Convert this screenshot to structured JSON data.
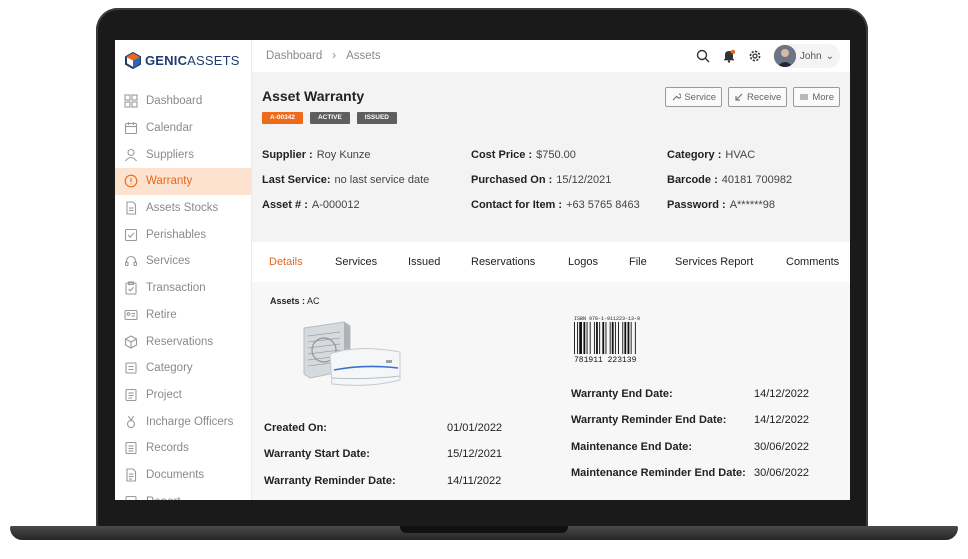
{
  "app": {
    "logo_prefix": "GENIC",
    "logo_suffix": "ASSETS"
  },
  "sidebar": {
    "items": [
      {
        "label": "Dashboard",
        "icon": "grid-icon",
        "active": false
      },
      {
        "label": "Calendar",
        "icon": "calendar-icon",
        "active": false
      },
      {
        "label": "Suppliers",
        "icon": "person-icon",
        "active": false
      },
      {
        "label": "Warranty",
        "icon": "alert-circle-icon",
        "active": true
      },
      {
        "label": "Assets Stocks",
        "icon": "document-icon",
        "active": false
      },
      {
        "label": "Perishables",
        "icon": "check-square-icon",
        "active": false
      },
      {
        "label": "Services",
        "icon": "headset-icon",
        "active": false
      },
      {
        "label": "Transaction",
        "icon": "clipboard-icon",
        "active": false
      },
      {
        "label": "Retire",
        "icon": "id-card-icon",
        "active": false
      },
      {
        "label": "Reservations",
        "icon": "cube-icon",
        "active": false
      },
      {
        "label": "Category",
        "icon": "tag-icon",
        "active": false
      },
      {
        "label": "Project",
        "icon": "list-icon",
        "active": false
      },
      {
        "label": "Incharge Officers",
        "icon": "medal-icon",
        "active": false
      },
      {
        "label": "Records",
        "icon": "records-icon",
        "active": false
      },
      {
        "label": "Documents",
        "icon": "documents-icon",
        "active": false
      },
      {
        "label": "Report",
        "icon": "report-icon",
        "active": false
      }
    ]
  },
  "topbar": {
    "breadcrumb": [
      "Dashboard",
      "Assets"
    ],
    "user_name": "John"
  },
  "asset": {
    "title": "Asset Warranty",
    "badges": [
      "A-00342",
      "ACTIVE",
      "ISSUED"
    ],
    "actions": [
      {
        "label": "Service",
        "icon": "wrench-icon"
      },
      {
        "label": "Receive",
        "icon": "arrow-down-left-icon"
      },
      {
        "label": "More",
        "icon": "menu-icon"
      }
    ],
    "info": {
      "col1": [
        {
          "key": "Supplier :",
          "value": "Roy Kunze"
        },
        {
          "key": "Last Service:",
          "value": "no last service date"
        },
        {
          "key": "Asset # :",
          "value": "A-000012"
        }
      ],
      "col2": [
        {
          "key": "Cost Price :",
          "value": "$750.00"
        },
        {
          "key": "Purchased On :",
          "value": "15/12/2021"
        },
        {
          "key": "Contact for Item :",
          "value": "+63 5765 8463"
        }
      ],
      "col3": [
        {
          "key": "Category :",
          "value": "HVAC"
        },
        {
          "key": "Barcode :",
          "value": "40181 700982"
        },
        {
          "key": "Password :",
          "value": "A******98"
        }
      ]
    }
  },
  "tabs": [
    "Details",
    "Services",
    "Issued",
    "Reservations",
    "Logos",
    "File",
    "Services Report",
    "Comments"
  ],
  "details": {
    "assets_label": "Assets :",
    "assets_value": "AC",
    "barcode_isbn": "ISBN 978-1-911223-13-9",
    "barcode_number": "781911 223139",
    "left_fields": [
      {
        "key": "Created On:",
        "value": "01/01/2022"
      },
      {
        "key": "Warranty Start Date:",
        "value": "15/12/2021"
      },
      {
        "key": "Warranty Reminder Date:",
        "value": "14/11/2022"
      }
    ],
    "right_fields": [
      {
        "key": "Warranty End Date:",
        "value": "14/12/2022"
      },
      {
        "key": "Warranty Reminder End Date:",
        "value": "14/12/2022"
      },
      {
        "key": "Maintenance End Date:",
        "value": "30/06/2022"
      },
      {
        "key": "Maintenance Reminder End Date:",
        "value": "30/06/2022"
      }
    ]
  },
  "colors": {
    "accent": "#e8671a",
    "accent_bg": "#fde3cf",
    "logo_blue": "#1f3c70",
    "badge_grey": "#5e5e5e"
  }
}
